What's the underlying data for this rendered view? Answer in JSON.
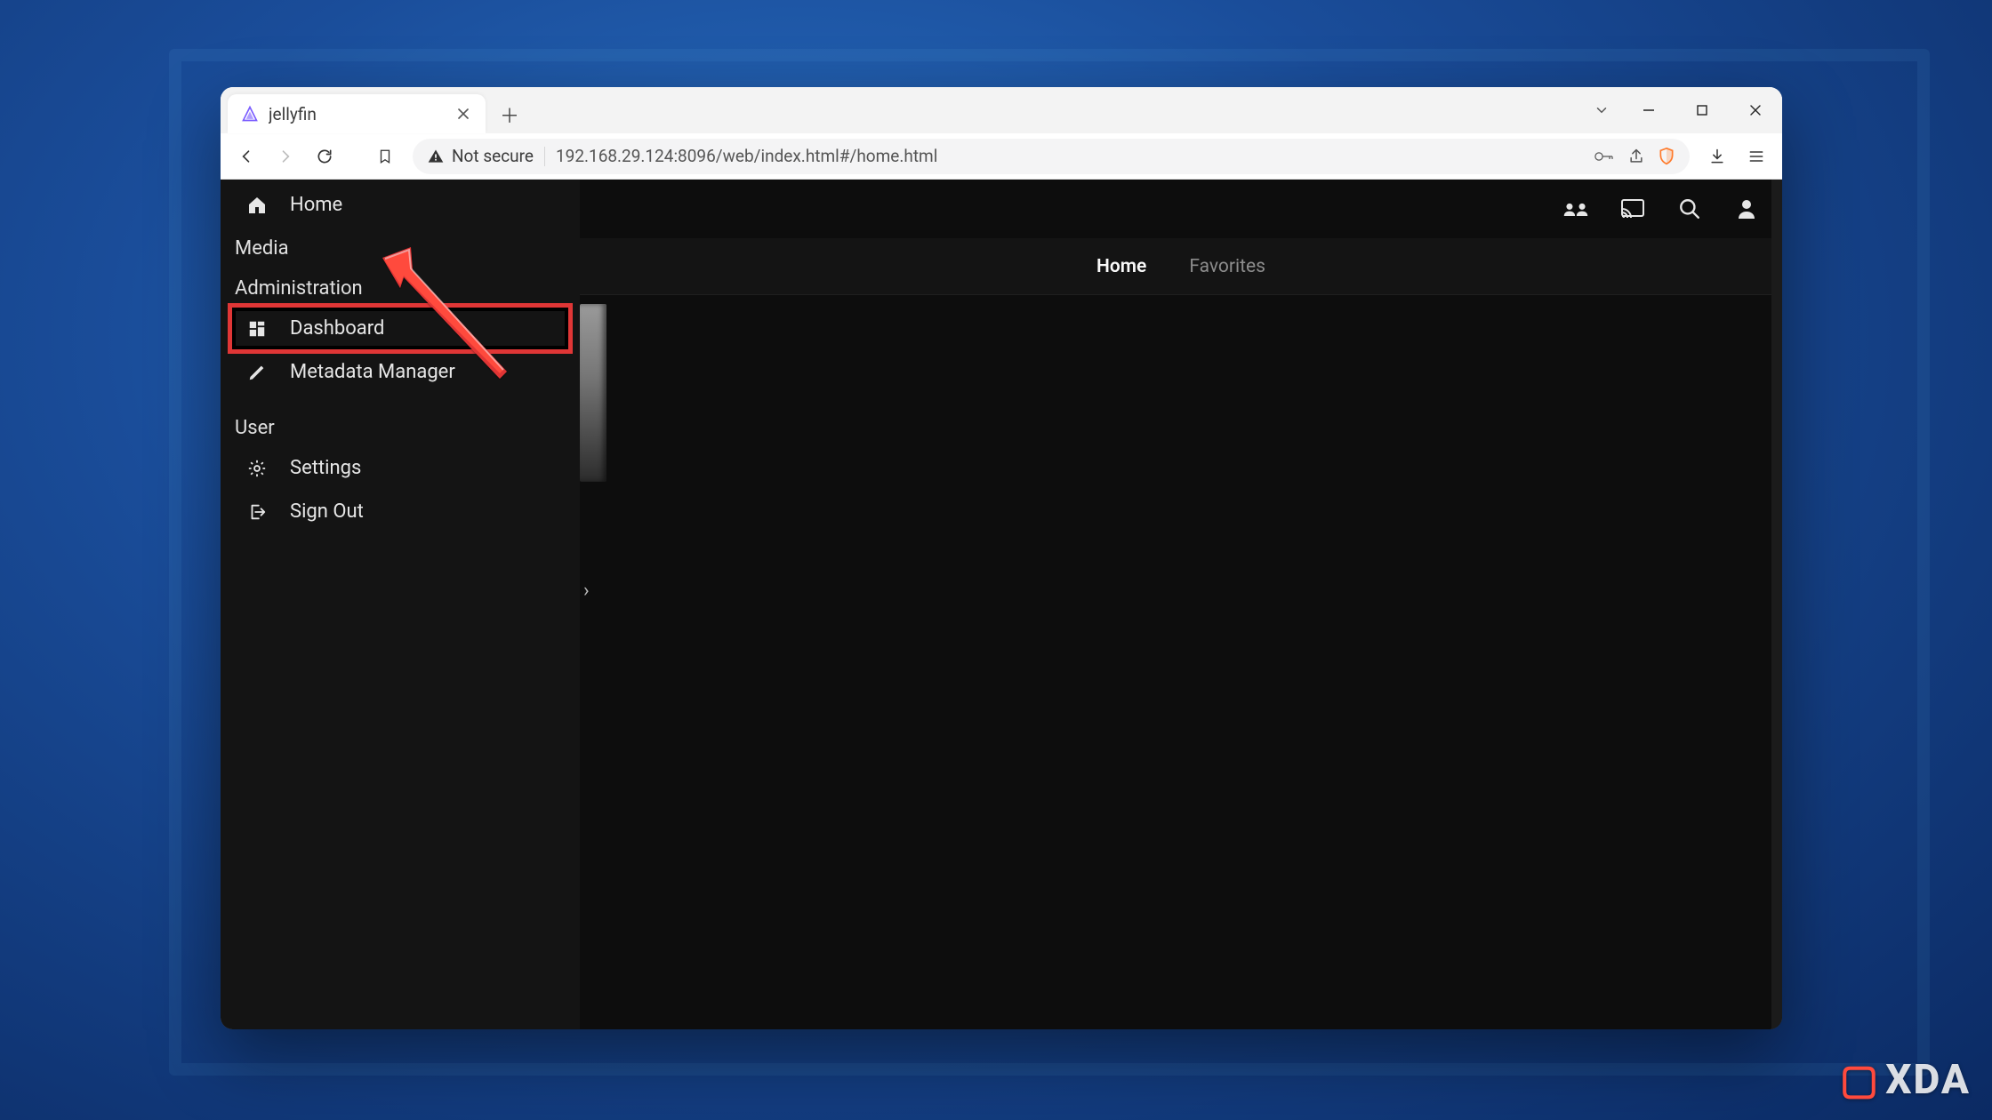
{
  "browser": {
    "tab_title": "jellyfin",
    "security_label": "Not secure",
    "url": "192.168.29.124:8096/web/index.html#/home.html"
  },
  "sidebar": {
    "home": "Home",
    "sections": {
      "media": "Media",
      "admin": "Administration",
      "user": "User"
    },
    "items": {
      "dashboard": "Dashboard",
      "metadata": "Metadata Manager",
      "settings": "Settings",
      "signout": "Sign Out"
    }
  },
  "tabs": {
    "home": "Home",
    "favorites": "Favorites"
  },
  "watermark": "XDA"
}
